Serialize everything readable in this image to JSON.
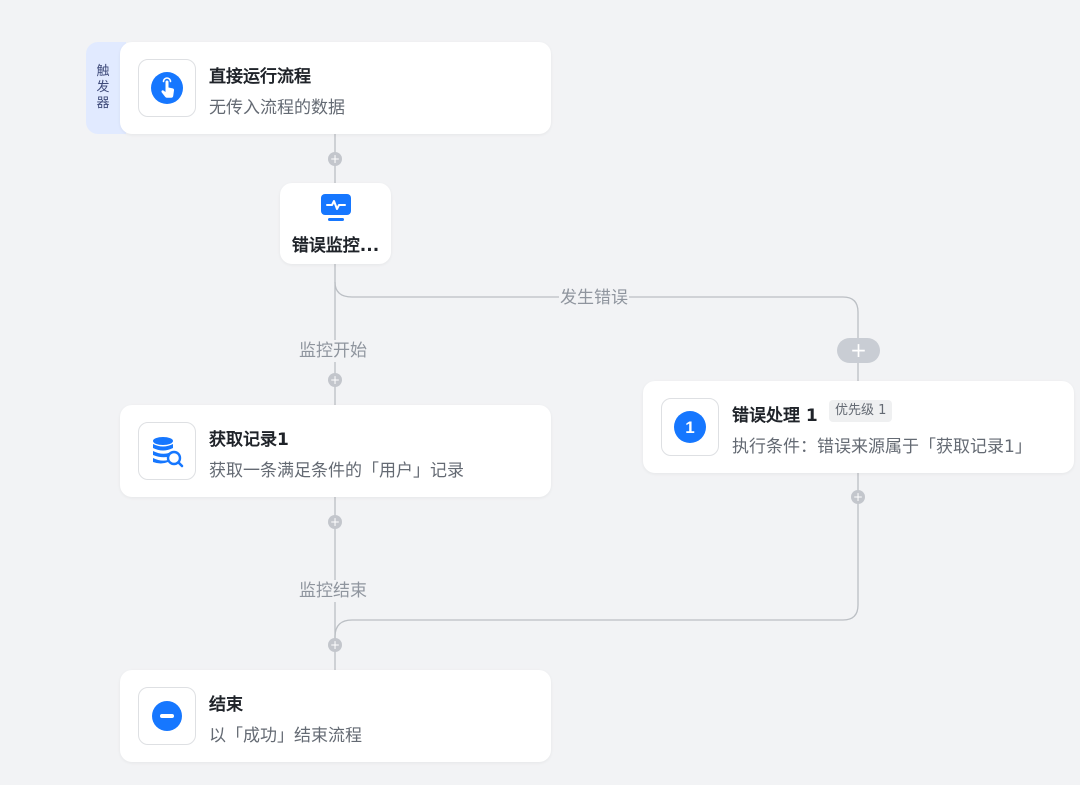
{
  "trigger": {
    "tag_chars": [
      "触",
      "发",
      "器"
    ],
    "title": "直接运行流程",
    "description": "无传入流程的数据",
    "icon": "tap-hand-icon"
  },
  "monitor_node": {
    "title": "错误监控...",
    "icon": "monitor-pulse-icon"
  },
  "edges": {
    "error_label": "发生错误",
    "monitor_start_label": "监控开始",
    "monitor_end_label": "监控结束"
  },
  "get_record_node": {
    "title": "获取记录1",
    "description": "获取一条满足条件的「用户」记录",
    "icon": "database-search-icon"
  },
  "error_handler_node": {
    "title": "错误处理 1",
    "priority_badge": "优先级 1",
    "description": "执行条件：错误来源属于「获取记录1」",
    "icon_number": "1"
  },
  "end_node": {
    "title": "结束",
    "description": "以「成功」结束流程",
    "icon": "minus-circle-icon"
  },
  "add_symbol": "+",
  "colors": {
    "background": "#f2f3f5",
    "accent": "#1677ff",
    "line": "#bbbfc4",
    "trigger_tag_bg": "#e1eaff"
  }
}
